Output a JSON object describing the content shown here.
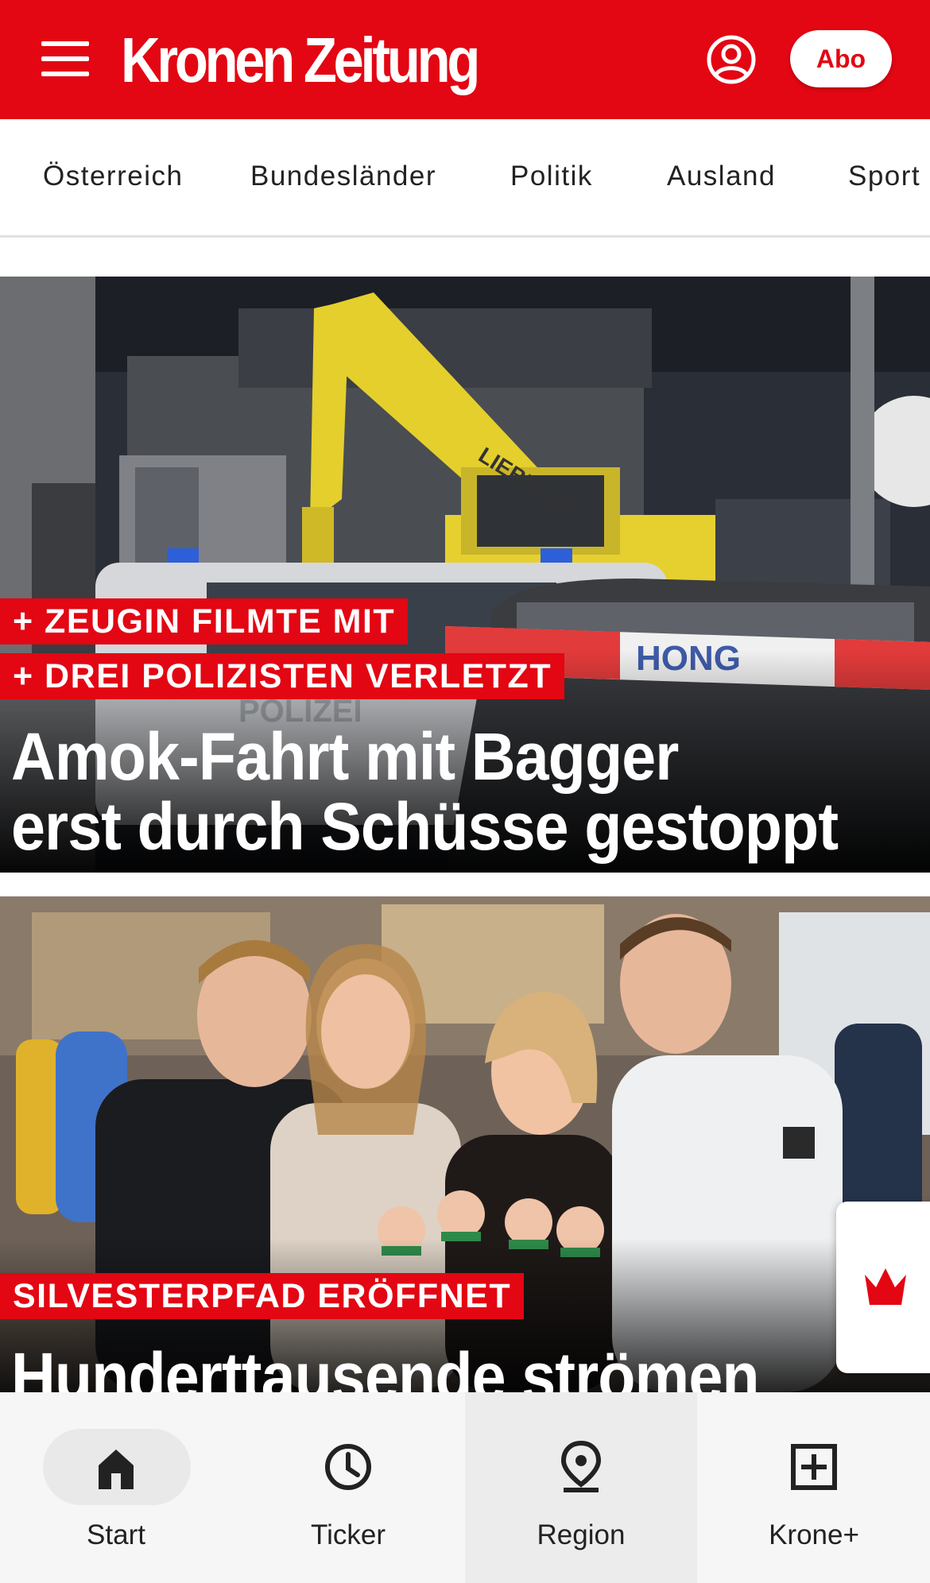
{
  "header": {
    "brand": "Kronen Zeitung",
    "account_icon": "user-circle-icon",
    "menu_icon": "hamburger-menu-icon",
    "abo_label": "Abo",
    "brand_color": "#e30613"
  },
  "nav": {
    "items": [
      "Österreich",
      "Bundesländer",
      "Politik",
      "Ausland",
      "Sport"
    ]
  },
  "articles": [
    {
      "kickers": [
        "+ ZEUGIN FILMTE MIT",
        "+ DREI POLIZISTEN VERLETZT"
      ],
      "headline_line1": "Amok-Fahrt mit Bagger",
      "headline_line2": "erst durch Schüsse gestoppt",
      "image_text": {
        "excavator_brand": "LIEBHERR",
        "police_text": "POLIZEI"
      }
    },
    {
      "kickers": [
        "SILVESTERPFAD ERÖFFNET"
      ],
      "headline_line1": "Hunderttausende strömen"
    }
  ],
  "floating_badge_icon": "krone-crown-icon",
  "bottom_nav": {
    "tabs": [
      {
        "label": "Start",
        "icon": "home-icon"
      },
      {
        "label": "Ticker",
        "icon": "clock-icon"
      },
      {
        "label": "Region",
        "icon": "location-pin-icon"
      },
      {
        "label": "Krone+",
        "icon": "plus-square-icon"
      }
    ],
    "active_tab": "Start"
  }
}
